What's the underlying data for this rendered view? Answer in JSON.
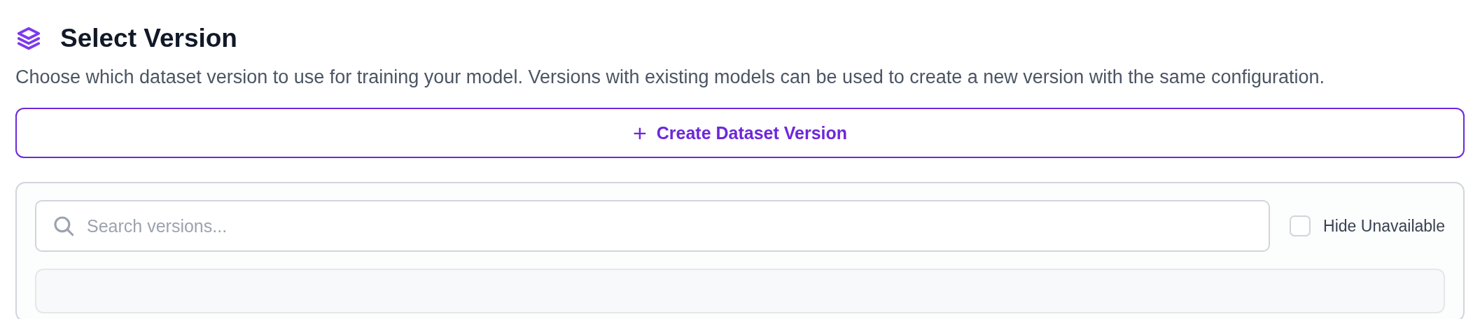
{
  "title": "Select Version",
  "description": "Choose which dataset version to use for training your model. Versions with existing models can be used to create a new version with the same configuration.",
  "create_button": {
    "icon": "+",
    "label": "Create Dataset Version"
  },
  "search": {
    "placeholder": "Search versions..."
  },
  "hide_unavailable": {
    "label": "Hide Unavailable",
    "checked": false
  }
}
